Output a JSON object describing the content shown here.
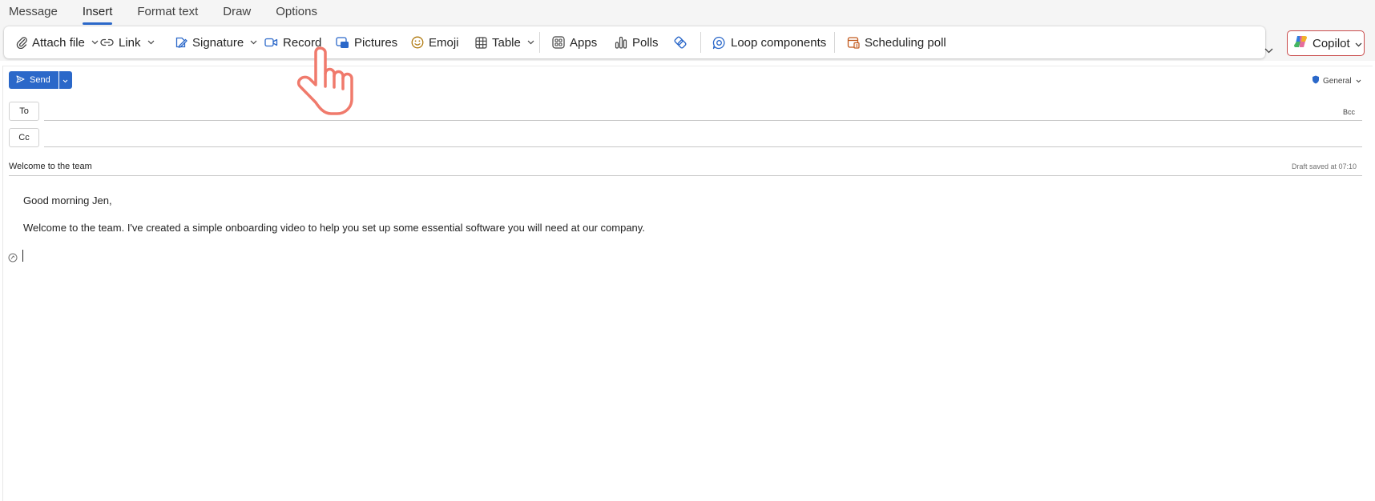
{
  "tabs": [
    {
      "label": "Message",
      "active": false
    },
    {
      "label": "Insert",
      "active": true
    },
    {
      "label": "Format text",
      "active": false
    },
    {
      "label": "Draw",
      "active": false
    },
    {
      "label": "Options",
      "active": false
    }
  ],
  "ribbon": {
    "attach_file": "Attach file",
    "link": "Link",
    "signature": "Signature",
    "record": "Record",
    "pictures": "Pictures",
    "emoji": "Emoji",
    "table": "Table",
    "apps": "Apps",
    "polls": "Polls",
    "loop_components": "Loop components",
    "scheduling_poll": "Scheduling poll"
  },
  "copilot": {
    "label": "Copilot"
  },
  "compose": {
    "send_label": "Send",
    "sensitivity_label": "General",
    "to_label": "To",
    "cc_label": "Cc",
    "bcc_label": "Bcc",
    "to_value": "",
    "cc_value": "",
    "subject": "Welcome to the team",
    "draft_status": "Draft saved at 07:10",
    "body": [
      "Good morning Jen,",
      "Welcome to the team. I've created a simple onboarding video to help you set up some essential software you will need at our company."
    ]
  },
  "colors": {
    "accent": "#2b68c9",
    "copilot_border": "#c94a4a",
    "pointer": "#f07a6c"
  },
  "icons": {
    "attach_file": "paperclip-icon",
    "link": "link-icon",
    "signature": "signature-pen-icon",
    "record": "video-camera-icon",
    "pictures": "picture-icon",
    "emoji": "smiley-icon",
    "table": "table-grid-icon",
    "apps": "apps-grid-icon",
    "polls": "bar-chart-icon",
    "loop": "loop-icon",
    "scheduling_poll": "calendar-poll-icon",
    "pointer": "hand-pointer-icon"
  }
}
